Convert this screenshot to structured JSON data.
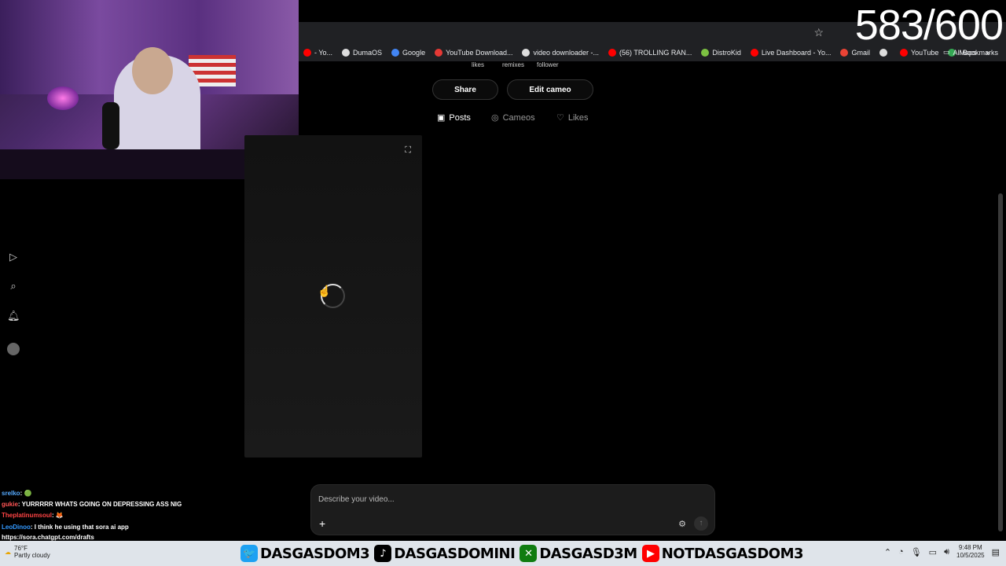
{
  "browser": {
    "bookmarks": [
      {
        "label": "- Yo...",
        "icon": "youtube-icon",
        "color": "#ff0000"
      },
      {
        "label": "DumaOS",
        "icon": "dumaos-icon",
        "color": "#dddddd"
      },
      {
        "label": "Google",
        "icon": "google-icon",
        "color": "#4285f4"
      },
      {
        "label": "YouTube Download...",
        "icon": "download-icon",
        "color": "#e53935"
      },
      {
        "label": "video downloader -...",
        "icon": "google-icon",
        "color": "#dddddd"
      },
      {
        "label": "(56) TROLLING RAN...",
        "icon": "youtube-icon",
        "color": "#ff0000"
      },
      {
        "label": "DistroKid",
        "icon": "distrokid-icon",
        "color": "#7cc142"
      },
      {
        "label": "Live Dashboard - Yo...",
        "icon": "youtube-icon",
        "color": "#ff0000"
      },
      {
        "label": "Gmail",
        "icon": "gmail-icon",
        "color": "#ea4335"
      },
      {
        "label": "",
        "icon": "globe-icon",
        "color": "#dddddd"
      },
      {
        "label": "YouTube",
        "icon": "youtube-icon",
        "color": "#ff0000"
      },
      {
        "label": "Maps",
        "icon": "maps-icon",
        "color": "#34a853"
      }
    ],
    "more": "»",
    "all_bookmarks": "All Bookmarks"
  },
  "overlay": {
    "counter": "583/600"
  },
  "profile": {
    "stat_likes": "likes",
    "stat_remixes": "remixes",
    "stat_follower": "follower",
    "share_label": "Share",
    "edit_cameo_label": "Edit cameo",
    "tabs": {
      "posts": "Posts",
      "cameos": "Cameos",
      "likes": "Likes"
    }
  },
  "composer": {
    "placeholder": "Describe your video...",
    "plus": "+",
    "send": "↑"
  },
  "chat": [
    {
      "user": "srelko",
      "user_color": "#55aaff",
      "message": ": 🟢"
    },
    {
      "user": "gukie",
      "user_color": "#ff5555",
      "message": ": YURRRRR WHATS GOING ON DEPRESSING ASS NIG"
    },
    {
      "user": "Theplatinumsoul",
      "user_color": "#ff4444",
      "message": ": 🦊"
    },
    {
      "user": "LeoDinoo",
      "user_color": "#3399ff",
      "message": ": I think he using that sora ai app"
    },
    {
      "user": "",
      "user_color": "#ffffff",
      "message": "https://sora.chatgpt.com/drafts"
    }
  ],
  "weather": {
    "temp": "76°F",
    "desc": "Partly cloudy"
  },
  "socials": [
    {
      "handle": "DASGASDOM3",
      "icon": "twitter-icon",
      "color": "#1da1f2",
      "glyph": "🐦"
    },
    {
      "handle": "DASGASDOMINI",
      "icon": "tiktok-icon",
      "color": "#000000",
      "glyph": "♪"
    },
    {
      "handle": "DASGASD3M",
      "icon": "xbox-icon",
      "color": "#107c10",
      "glyph": "✕"
    },
    {
      "handle": "NOTDASGASDOM3",
      "icon": "youtube-icon",
      "color": "#ff0000",
      "glyph": "▶"
    }
  ],
  "clock": {
    "time": "9:48 PM",
    "date": "10/5/2025"
  }
}
